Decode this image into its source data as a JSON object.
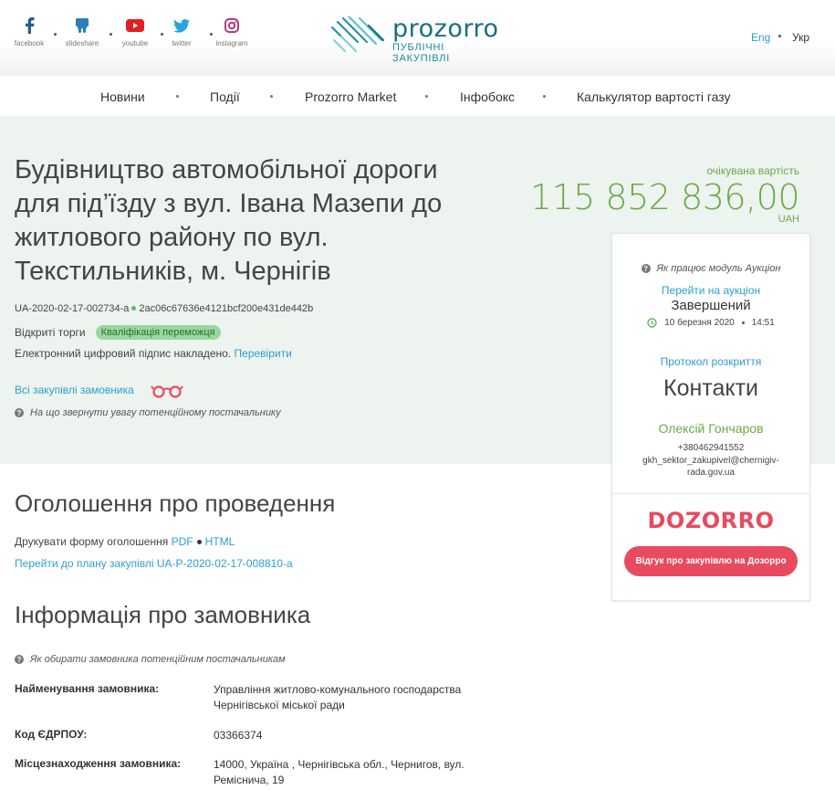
{
  "header": {
    "social": [
      {
        "label": "facebook",
        "icon": "facebook-icon"
      },
      {
        "label": "slideshare",
        "icon": "slideshare-icon"
      },
      {
        "label": "youtube",
        "icon": "youtube-icon"
      },
      {
        "label": "twitter",
        "icon": "twitter-icon"
      },
      {
        "label": "instagram",
        "icon": "instagram-icon"
      }
    ],
    "logo_word": "prozorro",
    "logo_sub": "ПУБЛІЧНІ ЗАКУПІВЛІ",
    "lang_en": "Eng",
    "lang_ua": "Укр"
  },
  "nav": [
    "Новини",
    "Події",
    "Prozorro Market",
    "Інфобокс",
    "Калькулятор вартості газу"
  ],
  "tender": {
    "title": "Будівництво автомобільної дороги для під’їзду з вул. Івана Мазепи до житлового району по вул. Текстильників, м. Чернігів",
    "id": "UA-2020-02-17-002734-a",
    "hash": "2ac06c67636e4121bcf200e431de442b",
    "procedure": "Відкриті торги",
    "status_badge": "Кваліфікація переможця",
    "signature_text": "Електронний цифровий підпис накладено.",
    "signature_link": "Перевірити",
    "all_procurements": "Всі закупівлі замовника",
    "hint_supplier": "На що звернути увагу потенційному постачальнику",
    "expected_label": "очікувана вартість",
    "expected_value": "115 852 836,00",
    "currency": "UAH"
  },
  "card": {
    "auction_help": "Як працює модуль Аукціон",
    "auction_link": "Перейти на аукціон",
    "auction_status": "Завершений",
    "auction_date": "10 березня 2020",
    "auction_time": "14:51",
    "protocol": "Протокол розкриття",
    "contacts_title": "Контакти",
    "contact_name": "Олексій Гончаров",
    "phone": "+380462941552",
    "email": "gkh_sektor_zakupivel@chernigiv-rada.gov.ua",
    "dozorro": "DOZORRO",
    "review_button": "Відгук про закупівлю на Дозорро"
  },
  "announcement": {
    "title": "Оголошення про проведення",
    "print_text": "Друкувати форму оголошення",
    "pdf": "PDF",
    "html": "HTML",
    "plan_link": "Перейти до плану закупівлі UA-P-2020-02-17-008810-a"
  },
  "customer": {
    "title": "Інформація про замовника",
    "hint": "Як обирати замовника потенційним постачальникам",
    "rows": [
      {
        "key": "Найменування замовника:",
        "value": "Управління житлово-комунального господарства Чернігівської міської ради"
      },
      {
        "key": "Код ЄДРПОУ:",
        "value": "03366374"
      },
      {
        "key": "Місцезнаходження замовника:",
        "value": "14000, Україна , Чернігівська обл., Чернигов, вул. Реміснича, 19"
      }
    ]
  },
  "colors": {
    "accent_blue": "#2b9fd1",
    "accent_green": "#6aaa4b",
    "dozorro_red": "#e84a5f",
    "hero_bg": "#edf3ee"
  }
}
